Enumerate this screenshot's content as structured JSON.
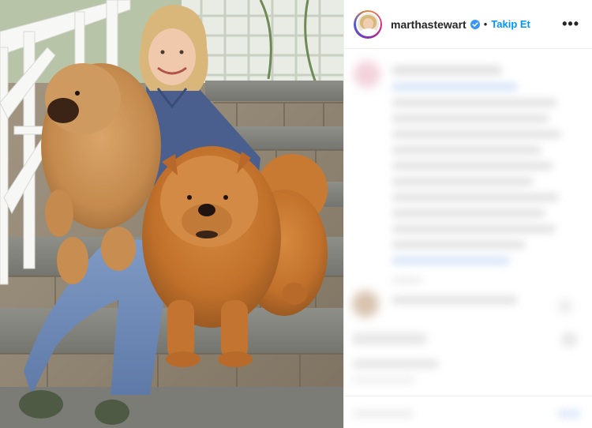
{
  "post": {
    "header": {
      "username": "marthastewart",
      "separator": "•",
      "follow_label": "Takip Et",
      "more_icon": "more-horizontal-icon"
    },
    "colors": {
      "link_blue": "#0095f6",
      "verified_blue": "#3897f0",
      "text_dark": "#262626",
      "divider": "#efefef"
    },
    "photo": {
      "content": "woman-with-two-chow-chow-dogs-on-stone-steps"
    },
    "panel_state": "caption-and-comments-blurred"
  }
}
